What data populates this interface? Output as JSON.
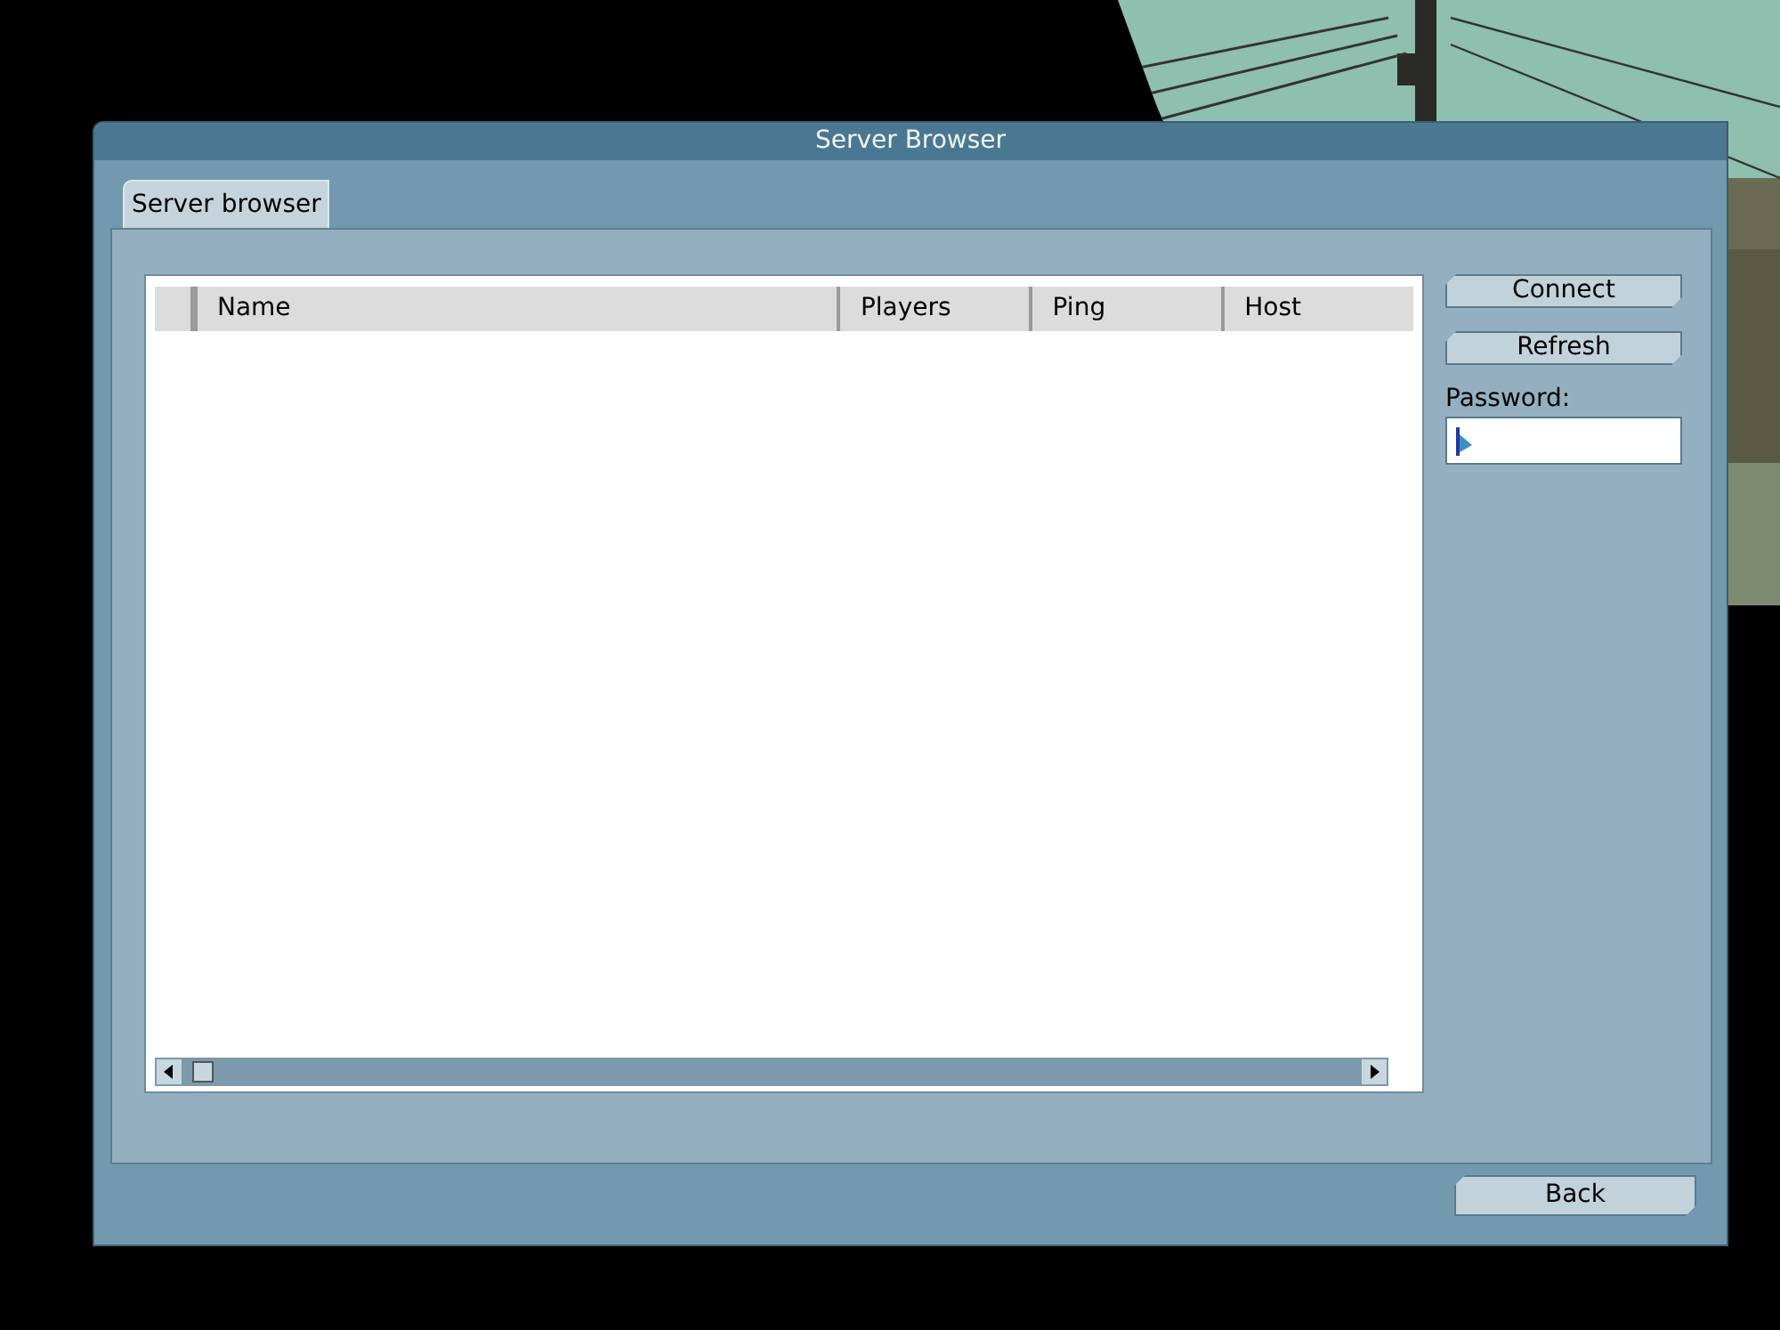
{
  "window": {
    "title": "Server Browser"
  },
  "tabs": [
    {
      "label": "Server browser",
      "selected": true
    }
  ],
  "table": {
    "columns": [
      "Name",
      "Players",
      "Ping",
      "Host"
    ]
  },
  "actions": [
    "Connect",
    "Refresh"
  ],
  "password": {
    "label": "Password:"
  },
  "footer": {
    "back": "Back"
  }
}
